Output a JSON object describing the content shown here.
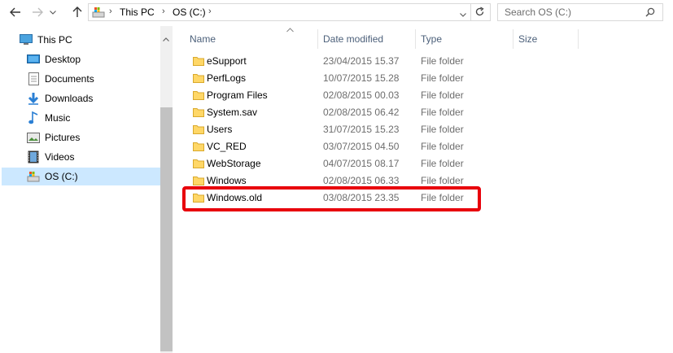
{
  "address": {
    "crumbs": [
      "This PC",
      "OS (C:)"
    ],
    "search_placeholder": "Search OS (C:)"
  },
  "nav_pane": {
    "items": [
      {
        "label": "This PC",
        "icon": "pc-icon"
      },
      {
        "label": "Desktop",
        "icon": "desktop-icon"
      },
      {
        "label": "Documents",
        "icon": "documents-icon"
      },
      {
        "label": "Downloads",
        "icon": "downloads-icon"
      },
      {
        "label": "Music",
        "icon": "music-icon"
      },
      {
        "label": "Pictures",
        "icon": "pictures-icon"
      },
      {
        "label": "Videos",
        "icon": "videos-icon"
      },
      {
        "label": "OS (C:)",
        "icon": "drive-icon",
        "selected": true
      }
    ]
  },
  "columns": {
    "name": "Name",
    "date": "Date modified",
    "type": "Type",
    "size": "Size"
  },
  "files": [
    {
      "name": "eSupport",
      "date": "23/04/2015 15.37",
      "type": "File folder"
    },
    {
      "name": "PerfLogs",
      "date": "10/07/2015 15.28",
      "type": "File folder"
    },
    {
      "name": "Program Files",
      "date": "02/08/2015 00.03",
      "type": "File folder"
    },
    {
      "name": "System.sav",
      "date": "02/08/2015 06.42",
      "type": "File folder"
    },
    {
      "name": "Users",
      "date": "31/07/2015 15.23",
      "type": "File folder"
    },
    {
      "name": "VC_RED",
      "date": "03/07/2015 04.50",
      "type": "File folder"
    },
    {
      "name": "WebStorage",
      "date": "04/07/2015 08.17",
      "type": "File folder"
    },
    {
      "name": "Windows",
      "date": "02/08/2015 06.33",
      "type": "File folder"
    },
    {
      "name": "Windows.old",
      "date": "03/08/2015 23.35",
      "type": "File folder"
    }
  ],
  "colors": {
    "highlight": "#e8000b",
    "selection": "#cce8ff",
    "folder": "#ffd767"
  }
}
